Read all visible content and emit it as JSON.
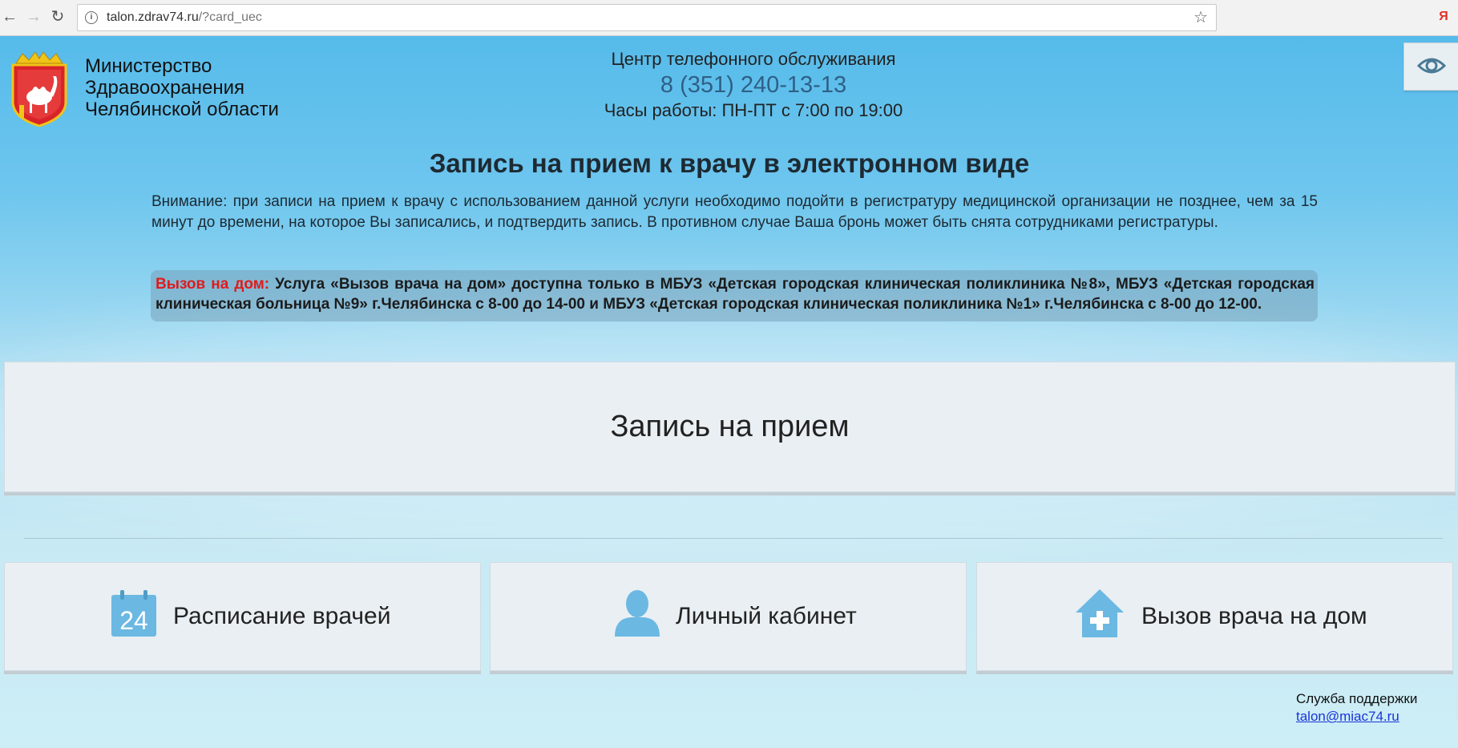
{
  "browser": {
    "url_host": "talon.zdrav74.ru",
    "url_path": "/?card_uec",
    "ya_label": "Я"
  },
  "header": {
    "ministry_line1": "Министерство",
    "ministry_line2": "Здравоохранения",
    "ministry_line3": "Челябинской области",
    "call_center_label": "Центр телефонного обслуживания",
    "phone": "8 (351) 240-13-13",
    "hours": "Часы работы: ПН-ПТ с 7:00 по 19:00"
  },
  "main": {
    "title": "Запись на прием к врачу в электронном виде",
    "notice": "Внимание: при записи на прием к врачу с использованием данной услуги необходимо подойти в регистратуру медицинской организации не позднее, чем за 15 минут до времени, на которое Вы записались, и подтвердить запись. В противном случае Ваша бронь может быть снята сотрудниками регистратуры.",
    "home_call_label": "Вызов на дом:",
    "home_call_text": "Услуга «Вызов врача на дом» доступна только в МБУЗ «Детская городская клиническая поликлиника №8», МБУЗ «Детская городская клиническая больница №9» г.Челябинска с 8-00 до 14-00 и МБУЗ «Детская городская клиническая поликлиника №1» г.Челябинска с 8-00 до 12-00.",
    "appointment_button": "Запись на прием",
    "schedule_button": "Расписание врачей",
    "schedule_icon_day": "24",
    "cabinet_button": "Личный кабинет",
    "home_doctor_button": "Вызов врача на дом"
  },
  "footer": {
    "support_label": "Служба поддержки",
    "support_email": "talon@miac74.ru"
  },
  "colors": {
    "accent_red": "#e01b1b",
    "icon_blue": "#6bb8e3",
    "link_blue": "#1a35d8"
  }
}
